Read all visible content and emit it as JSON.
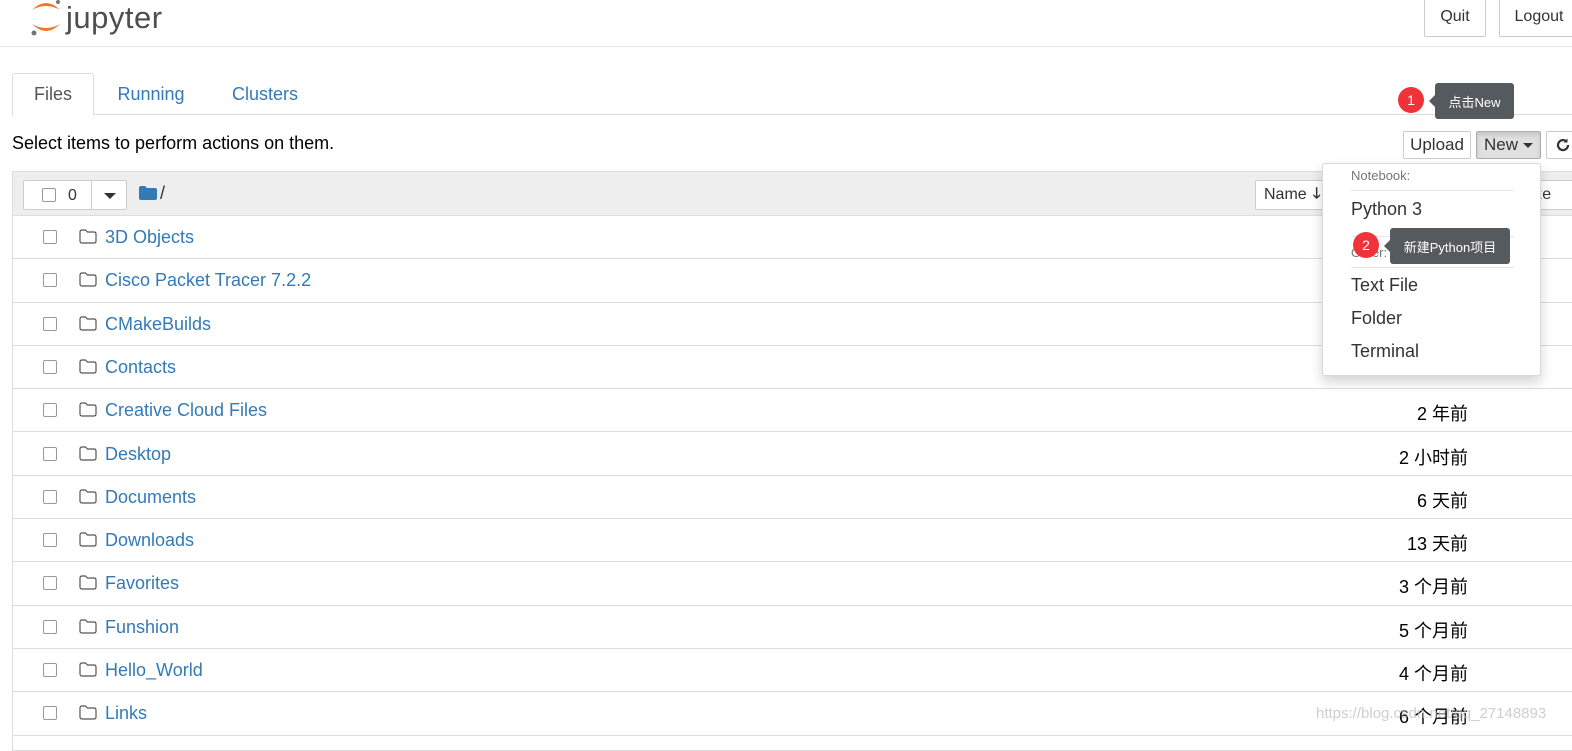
{
  "header": {
    "logo_text": "jupyter",
    "quit_label": "Quit",
    "logout_label": "Logout"
  },
  "tabs": [
    {
      "label": "Files"
    },
    {
      "label": "Running"
    },
    {
      "label": "Clusters"
    }
  ],
  "toolbar": {
    "hint": "Select items to perform actions on them.",
    "upload_label": "Upload",
    "new_label": "New"
  },
  "list_header": {
    "selected_count": "0",
    "path": "/",
    "name_sort_label": "Name",
    "size_sort_label": "Size"
  },
  "files": [
    {
      "name": "3D Objects",
      "modified": ""
    },
    {
      "name": "Cisco Packet Tracer 7.2.2",
      "modified": ""
    },
    {
      "name": "CMakeBuilds",
      "modified": ""
    },
    {
      "name": "Contacts",
      "modified": ""
    },
    {
      "name": "Creative Cloud Files",
      "modified": "2 年前"
    },
    {
      "name": "Desktop",
      "modified": "2 小时前"
    },
    {
      "name": "Documents",
      "modified": "6 天前"
    },
    {
      "name": "Downloads",
      "modified": "13 天前"
    },
    {
      "name": "Favorites",
      "modified": "3 个月前"
    },
    {
      "name": "Funshion",
      "modified": "5 个月前"
    },
    {
      "name": "Hello_World",
      "modified": "4 个月前"
    },
    {
      "name": "Links",
      "modified": "6 个月前"
    }
  ],
  "new_menu": {
    "notebook_header": "Notebook:",
    "python3": "Python 3",
    "other_header": "Other:",
    "text_file": "Text File",
    "folder": "Folder",
    "terminal": "Terminal"
  },
  "annotations": {
    "step1_number": "1",
    "step1_text": "点击New",
    "step2_number": "2",
    "step2_text": "新建Python项目"
  },
  "watermark": "https://blog.csdn.net/qq_27148893",
  "colors": {
    "link": "#337ab7",
    "badge": "#f0333a",
    "tooltip": "#555a5e",
    "logo_orange": "#f37626"
  }
}
